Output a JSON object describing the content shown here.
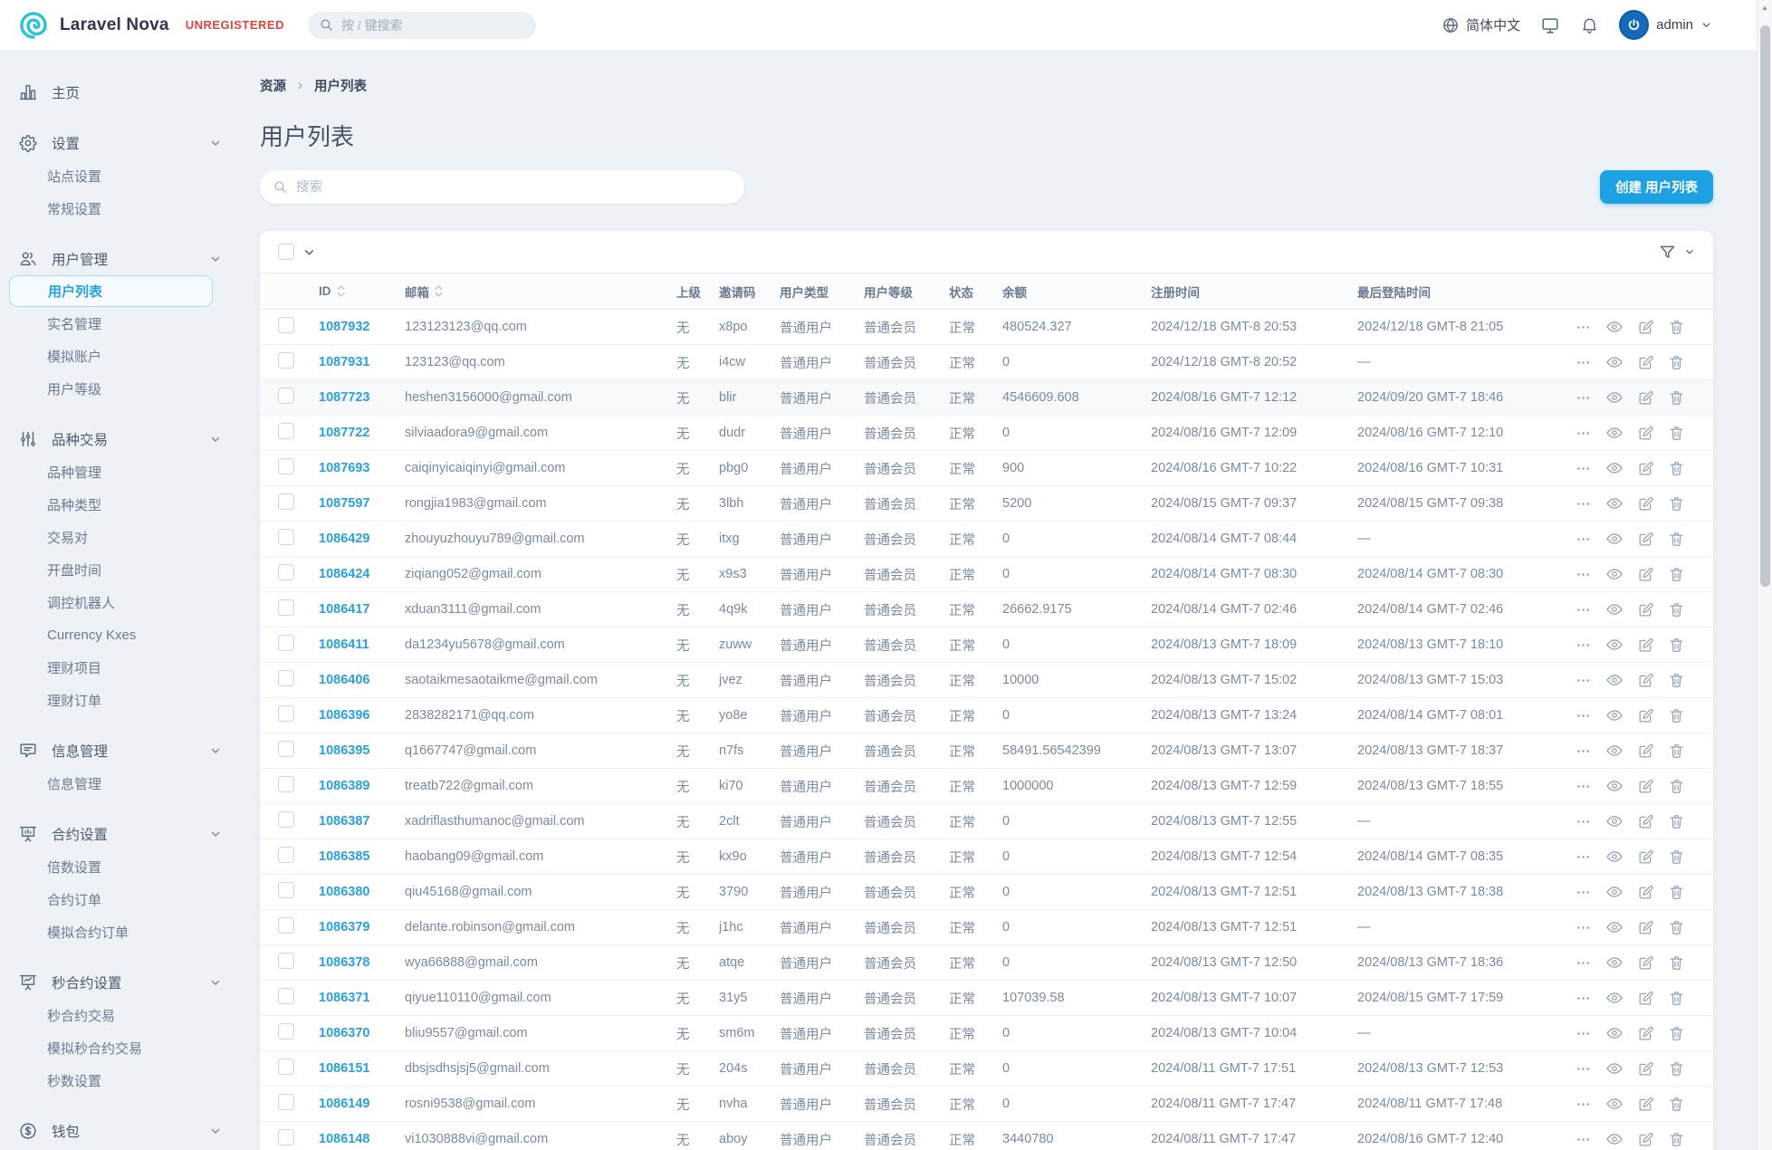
{
  "colors": {
    "accent_blue": "#1da1e4",
    "link_blue": "#2aa0e2",
    "badge_red": "#e6403c",
    "active_nav_blue": "#27a3e3",
    "page_background": "#eef2f6"
  },
  "header": {
    "brand": "Laravel Nova",
    "badge": "UNREGISTERED",
    "search_placeholder": "按 / 键搜索",
    "language": "简体中文",
    "user": "admin"
  },
  "sidebar": {
    "groups": [
      {
        "label": "主页",
        "icon": "chart-bar-icon",
        "chevron": false,
        "items": []
      },
      {
        "label": "设置",
        "icon": "gear-icon",
        "chevron": true,
        "items": [
          {
            "label": "站点设置"
          },
          {
            "label": "常规设置"
          }
        ]
      },
      {
        "label": "用户管理",
        "icon": "users-icon",
        "chevron": true,
        "items": [
          {
            "label": "用户列表",
            "active": true
          },
          {
            "label": "实名管理"
          },
          {
            "label": "模拟账户"
          },
          {
            "label": "用户等级"
          }
        ]
      },
      {
        "label": "品种交易",
        "icon": "sliders-icon",
        "chevron": true,
        "items": [
          {
            "label": "品种管理"
          },
          {
            "label": "品种类型"
          },
          {
            "label": "交易对"
          },
          {
            "label": "开盘时间"
          },
          {
            "label": "调控机器人"
          },
          {
            "label": "Currency Kxes"
          },
          {
            "label": "理财项目"
          },
          {
            "label": "理财订单"
          }
        ]
      },
      {
        "label": "信息管理",
        "icon": "chat-icon",
        "chevron": true,
        "items": [
          {
            "label": "信息管理"
          }
        ]
      },
      {
        "label": "合约设置",
        "icon": "presentation-board-icon",
        "chevron": true,
        "items": [
          {
            "label": "倍数设置"
          },
          {
            "label": "合约订单"
          },
          {
            "label": "模拟合约订单"
          }
        ]
      },
      {
        "label": "秒合约设置",
        "icon": "presentation-chart-icon",
        "chevron": true,
        "items": [
          {
            "label": "秒合约交易"
          },
          {
            "label": "模拟秒合约交易"
          },
          {
            "label": "秒数设置"
          }
        ]
      },
      {
        "label": "钱包",
        "icon": "currency-dollar-icon",
        "chevron": true,
        "items": []
      }
    ]
  },
  "main": {
    "breadcrumb": {
      "root": "资源",
      "current": "用户列表"
    },
    "title": "用户列表",
    "search_placeholder": "搜索",
    "create_button": "创建 用户列表",
    "table": {
      "columns": [
        {
          "label": "ID",
          "sortable": true
        },
        {
          "label": "邮箱",
          "sortable": true
        },
        {
          "label": "上级"
        },
        {
          "label": "邀请码"
        },
        {
          "label": "用户类型"
        },
        {
          "label": "用户等级"
        },
        {
          "label": "状态"
        },
        {
          "label": "余额"
        },
        {
          "label": "注册时间"
        },
        {
          "label": "最后登陆时间"
        }
      ],
      "rows": [
        {
          "id": "1087932",
          "email": "123123123@qq.com",
          "parent": "无",
          "invite": "x8po",
          "type": "普通用户",
          "level": "普通会员",
          "status": "正常",
          "balance": "480524.327",
          "registered": "2024/12/18 GMT-8 20:53",
          "last_login": "2024/12/18 GMT-8 21:05"
        },
        {
          "id": "1087931",
          "email": "123123@qq.com",
          "parent": "无",
          "invite": "i4cw",
          "type": "普通用户",
          "level": "普通会员",
          "status": "正常",
          "balance": "0",
          "registered": "2024/12/18 GMT-8 20:52",
          "last_login": "—"
        },
        {
          "id": "1087723",
          "email": "heshen3156000@gmail.com",
          "parent": "无",
          "invite": "blir",
          "type": "普通用户",
          "level": "普通会员",
          "status": "正常",
          "balance": "4546609.608",
          "registered": "2024/08/16 GMT-7 12:12",
          "last_login": "2024/09/20 GMT-7 18:46",
          "highlighted": true
        },
        {
          "id": "1087722",
          "email": "silviaadora9@gmail.com",
          "parent": "无",
          "invite": "dudr",
          "type": "普通用户",
          "level": "普通会员",
          "status": "正常",
          "balance": "0",
          "registered": "2024/08/16 GMT-7 12:09",
          "last_login": "2024/08/16 GMT-7 12:10"
        },
        {
          "id": "1087693",
          "email": "caiqinyicaiqinyi@gmail.com",
          "parent": "无",
          "invite": "pbg0",
          "type": "普通用户",
          "level": "普通会员",
          "status": "正常",
          "balance": "900",
          "registered": "2024/08/16 GMT-7 10:22",
          "last_login": "2024/08/16 GMT-7 10:31"
        },
        {
          "id": "1087597",
          "email": "rongjia1983@gmail.com",
          "parent": "无",
          "invite": "3lbh",
          "type": "普通用户",
          "level": "普通会员",
          "status": "正常",
          "balance": "5200",
          "registered": "2024/08/15 GMT-7 09:37",
          "last_login": "2024/08/15 GMT-7 09:38"
        },
        {
          "id": "1086429",
          "email": "zhouyuzhouyu789@gmail.com",
          "parent": "无",
          "invite": "itxg",
          "type": "普通用户",
          "level": "普通会员",
          "status": "正常",
          "balance": "0",
          "registered": "2024/08/14 GMT-7 08:44",
          "last_login": "—"
        },
        {
          "id": "1086424",
          "email": "ziqiang052@gmail.com",
          "parent": "无",
          "invite": "x9s3",
          "type": "普通用户",
          "level": "普通会员",
          "status": "正常",
          "balance": "0",
          "registered": "2024/08/14 GMT-7 08:30",
          "last_login": "2024/08/14 GMT-7 08:30"
        },
        {
          "id": "1086417",
          "email": "xduan3111@gmail.com",
          "parent": "无",
          "invite": "4q9k",
          "type": "普通用户",
          "level": "普通会员",
          "status": "正常",
          "balance": "26662.9175",
          "registered": "2024/08/14 GMT-7 02:46",
          "last_login": "2024/08/14 GMT-7 02:46"
        },
        {
          "id": "1086411",
          "email": "da1234yu5678@gmail.com",
          "parent": "无",
          "invite": "zuww",
          "type": "普通用户",
          "level": "普通会员",
          "status": "正常",
          "balance": "0",
          "registered": "2024/08/13 GMT-7 18:09",
          "last_login": "2024/08/13 GMT-7 18:10"
        },
        {
          "id": "1086406",
          "email": "saotaikmesaotaikme@gmail.com",
          "parent": "无",
          "invite": "jvez",
          "type": "普通用户",
          "level": "普通会员",
          "status": "正常",
          "balance": "10000",
          "registered": "2024/08/13 GMT-7 15:02",
          "last_login": "2024/08/13 GMT-7 15:03"
        },
        {
          "id": "1086396",
          "email": "2838282171@qq.com",
          "parent": "无",
          "invite": "yo8e",
          "type": "普通用户",
          "level": "普通会员",
          "status": "正常",
          "balance": "0",
          "registered": "2024/08/13 GMT-7 13:24",
          "last_login": "2024/08/14 GMT-7 08:01"
        },
        {
          "id": "1086395",
          "email": "q1667747@gmail.com",
          "parent": "无",
          "invite": "n7fs",
          "type": "普通用户",
          "level": "普通会员",
          "status": "正常",
          "balance": "58491.56542399",
          "registered": "2024/08/13 GMT-7 13:07",
          "last_login": "2024/08/13 GMT-7 18:37"
        },
        {
          "id": "1086389",
          "email": "treatb722@gmail.com",
          "parent": "无",
          "invite": "ki70",
          "type": "普通用户",
          "level": "普通会员",
          "status": "正常",
          "balance": "1000000",
          "registered": "2024/08/13 GMT-7 12:59",
          "last_login": "2024/08/13 GMT-7 18:55"
        },
        {
          "id": "1086387",
          "email": "xadriflasthumanoc@gmail.com",
          "parent": "无",
          "invite": "2clt",
          "type": "普通用户",
          "level": "普通会员",
          "status": "正常",
          "balance": "0",
          "registered": "2024/08/13 GMT-7 12:55",
          "last_login": "—"
        },
        {
          "id": "1086385",
          "email": "haobang09@gmail.com",
          "parent": "无",
          "invite": "kx9o",
          "type": "普通用户",
          "level": "普通会员",
          "status": "正常",
          "balance": "0",
          "registered": "2024/08/13 GMT-7 12:54",
          "last_login": "2024/08/14 GMT-7 08:35"
        },
        {
          "id": "1086380",
          "email": "qiu45168@gmail.com",
          "parent": "无",
          "invite": "3790",
          "type": "普通用户",
          "level": "普通会员",
          "status": "正常",
          "balance": "0",
          "registered": "2024/08/13 GMT-7 12:51",
          "last_login": "2024/08/13 GMT-7 18:38"
        },
        {
          "id": "1086379",
          "email": "delante.robinson@gmail.com",
          "parent": "无",
          "invite": "j1hc",
          "type": "普通用户",
          "level": "普通会员",
          "status": "正常",
          "balance": "0",
          "registered": "2024/08/13 GMT-7 12:51",
          "last_login": "—"
        },
        {
          "id": "1086378",
          "email": "wya66888@gmail.com",
          "parent": "无",
          "invite": "atqe",
          "type": "普通用户",
          "level": "普通会员",
          "status": "正常",
          "balance": "0",
          "registered": "2024/08/13 GMT-7 12:50",
          "last_login": "2024/08/13 GMT-7 18:36"
        },
        {
          "id": "1086371",
          "email": "qiyue110110@gmail.com",
          "parent": "无",
          "invite": "31y5",
          "type": "普通用户",
          "level": "普通会员",
          "status": "正常",
          "balance": "107039.58",
          "registered": "2024/08/13 GMT-7 10:07",
          "last_login": "2024/08/15 GMT-7 17:59"
        },
        {
          "id": "1086370",
          "email": "bliu9557@gmail.com",
          "parent": "无",
          "invite": "sm6m",
          "type": "普通用户",
          "level": "普通会员",
          "status": "正常",
          "balance": "0",
          "registered": "2024/08/13 GMT-7 10:04",
          "last_login": "—"
        },
        {
          "id": "1086151",
          "email": "dbsjsdhsjsj5@gmail.com",
          "parent": "无",
          "invite": "204s",
          "type": "普通用户",
          "level": "普通会员",
          "status": "正常",
          "balance": "0",
          "registered": "2024/08/11 GMT-7 17:51",
          "last_login": "2024/08/13 GMT-7 12:53"
        },
        {
          "id": "1086149",
          "email": "rosni9538@gmail.com",
          "parent": "无",
          "invite": "nvha",
          "type": "普通用户",
          "level": "普通会员",
          "status": "正常",
          "balance": "0",
          "registered": "2024/08/11 GMT-7 17:47",
          "last_login": "2024/08/11 GMT-7 17:48"
        },
        {
          "id": "1086148",
          "email": "vi1030888vi@gmail.com",
          "parent": "无",
          "invite": "aboy",
          "type": "普通用户",
          "level": "普通会员",
          "status": "正常",
          "balance": "3440780",
          "registered": "2024/08/11 GMT-7 17:47",
          "last_login": "2024/08/16 GMT-7 12:40"
        }
      ]
    }
  }
}
